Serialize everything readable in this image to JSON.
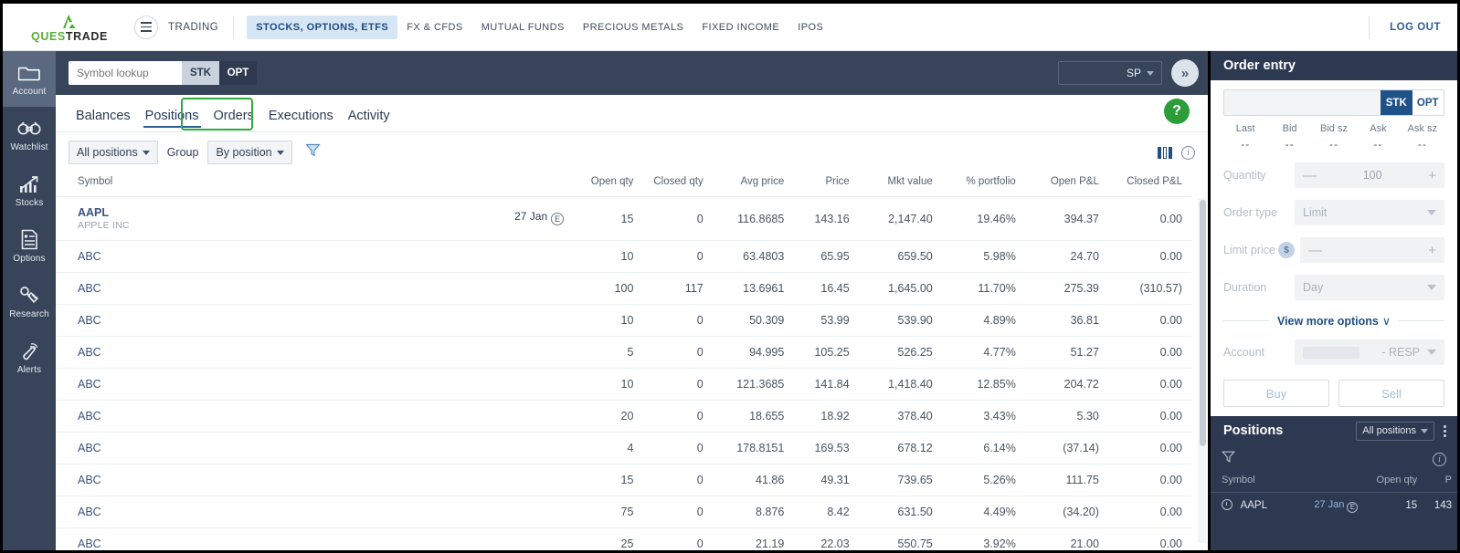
{
  "brand": {
    "name_part1": "QUES",
    "name_part2": "TRADE"
  },
  "topnav": {
    "trading_label": "TRADING",
    "items": [
      {
        "label": "STOCKS, OPTIONS, ETFS",
        "active": true
      },
      {
        "label": "FX & CFDS",
        "active": false
      },
      {
        "label": "MUTUAL FUNDS",
        "active": false
      },
      {
        "label": "PRECIOUS METALS",
        "active": false
      },
      {
        "label": "FIXED INCOME",
        "active": false
      },
      {
        "label": "IPOS",
        "active": false
      }
    ],
    "logout": "LOG OUT"
  },
  "rail": {
    "items": [
      {
        "label": "Account",
        "icon": "folder-icon",
        "active": true
      },
      {
        "label": "Watchlist",
        "icon": "binoculars-icon",
        "active": false
      },
      {
        "label": "Stocks",
        "icon": "chart-up-icon",
        "active": false
      },
      {
        "label": "Options",
        "icon": "document-person-icon",
        "active": false
      },
      {
        "label": "Research",
        "icon": "satellite-icon",
        "active": false
      },
      {
        "label": "Alerts",
        "icon": "bell-icon",
        "active": false
      }
    ]
  },
  "search": {
    "placeholder": "Symbol lookup",
    "value": "",
    "stk_label": "STK",
    "opt_label": "OPT",
    "account_selector": "SP",
    "expand_label": "»"
  },
  "tabs": [
    {
      "label": "Balances",
      "active": false
    },
    {
      "label": "Positions",
      "active": true
    },
    {
      "label": "Orders",
      "active": false
    },
    {
      "label": "Executions",
      "active": false
    },
    {
      "label": "Activity",
      "active": false
    }
  ],
  "help_label": "?",
  "toolbar": {
    "positions_filter": "All positions",
    "group_label": "Group",
    "group_value": "By position",
    "funnel_icon": "filter-funnel-icon",
    "columns_icon": "columns-icon",
    "info_icon": "info-icon"
  },
  "table": {
    "columns": [
      "Symbol",
      "Open qty",
      "Closed qty",
      "Avg price",
      "Price",
      "Mkt value",
      "% portfolio",
      "Open P&L",
      "Closed P&L"
    ],
    "rows": [
      {
        "symbol": "AAPL",
        "desc": "APPLE INC",
        "expiry": "27 Jan",
        "expiry_badge": "E",
        "open_qty": "15",
        "closed_qty": "0",
        "avg_price": "116.8685",
        "price": "143.16",
        "mkt_value": "2,147.40",
        "pct_portfolio": "19.46%",
        "open_pl": "394.37",
        "open_pl_sign": "pos",
        "closed_pl": "0.00",
        "closed_pl_sign": "neutral"
      },
      {
        "symbol": "ABC",
        "desc": "",
        "expiry": "",
        "expiry_badge": "",
        "open_qty": "10",
        "closed_qty": "0",
        "avg_price": "63.4803",
        "price": "65.95",
        "mkt_value": "659.50",
        "pct_portfolio": "5.98%",
        "open_pl": "24.70",
        "open_pl_sign": "pos",
        "closed_pl": "0.00",
        "closed_pl_sign": "neutral"
      },
      {
        "symbol": "ABC",
        "desc": "",
        "expiry": "",
        "expiry_badge": "",
        "open_qty": "100",
        "closed_qty": "117",
        "avg_price": "13.6961",
        "price": "16.45",
        "mkt_value": "1,645.00",
        "pct_portfolio": "11.70%",
        "open_pl": "275.39",
        "open_pl_sign": "pos",
        "closed_pl": "(310.57)",
        "closed_pl_sign": "neg"
      },
      {
        "symbol": "ABC",
        "desc": "",
        "expiry": "",
        "expiry_badge": "",
        "open_qty": "10",
        "closed_qty": "0",
        "avg_price": "50.309",
        "price": "53.99",
        "mkt_value": "539.90",
        "pct_portfolio": "4.89%",
        "open_pl": "36.81",
        "open_pl_sign": "pos",
        "closed_pl": "0.00",
        "closed_pl_sign": "neutral"
      },
      {
        "symbol": "ABC",
        "desc": "",
        "expiry": "",
        "expiry_badge": "",
        "open_qty": "5",
        "closed_qty": "0",
        "avg_price": "94.995",
        "price": "105.25",
        "mkt_value": "526.25",
        "pct_portfolio": "4.77%",
        "open_pl": "51.27",
        "open_pl_sign": "pos",
        "closed_pl": "0.00",
        "closed_pl_sign": "neutral"
      },
      {
        "symbol": "ABC",
        "desc": "",
        "expiry": "",
        "expiry_badge": "",
        "open_qty": "10",
        "closed_qty": "0",
        "avg_price": "121.3685",
        "price": "141.84",
        "mkt_value": "1,418.40",
        "pct_portfolio": "12.85%",
        "open_pl": "204.72",
        "open_pl_sign": "pos",
        "closed_pl": "0.00",
        "closed_pl_sign": "neutral"
      },
      {
        "symbol": "ABC",
        "desc": "",
        "expiry": "",
        "expiry_badge": "",
        "open_qty": "20",
        "closed_qty": "0",
        "avg_price": "18.655",
        "price": "18.92",
        "mkt_value": "378.40",
        "pct_portfolio": "3.43%",
        "open_pl": "5.30",
        "open_pl_sign": "pos",
        "closed_pl": "0.00",
        "closed_pl_sign": "neutral"
      },
      {
        "symbol": "ABC",
        "desc": "",
        "expiry": "",
        "expiry_badge": "",
        "open_qty": "4",
        "closed_qty": "0",
        "avg_price": "178.8151",
        "price": "169.53",
        "mkt_value": "678.12",
        "pct_portfolio": "6.14%",
        "open_pl": "(37.14)",
        "open_pl_sign": "neg",
        "closed_pl": "0.00",
        "closed_pl_sign": "neutral"
      },
      {
        "symbol": "ABC",
        "desc": "",
        "expiry": "",
        "expiry_badge": "",
        "open_qty": "15",
        "closed_qty": "0",
        "avg_price": "41.86",
        "price": "49.31",
        "mkt_value": "739.65",
        "pct_portfolio": "5.26%",
        "open_pl": "111.75",
        "open_pl_sign": "pos",
        "closed_pl": "0.00",
        "closed_pl_sign": "neutral"
      },
      {
        "symbol": "ABC",
        "desc": "",
        "expiry": "",
        "expiry_badge": "",
        "open_qty": "75",
        "closed_qty": "0",
        "avg_price": "8.876",
        "price": "8.42",
        "mkt_value": "631.50",
        "pct_portfolio": "4.49%",
        "open_pl": "(34.20)",
        "open_pl_sign": "neg",
        "closed_pl": "0.00",
        "closed_pl_sign": "neutral"
      },
      {
        "symbol": "ABC",
        "desc": "",
        "expiry": "",
        "expiry_badge": "",
        "open_qty": "25",
        "closed_qty": "0",
        "avg_price": "21.19",
        "price": "22.03",
        "mkt_value": "550.75",
        "pct_portfolio": "3.92%",
        "open_pl": "21.00",
        "open_pl_sign": "pos",
        "closed_pl": "0.00",
        "closed_pl_sign": "neutral"
      }
    ]
  },
  "order_entry": {
    "title": "Order entry",
    "symbol_value": "",
    "stk_label": "STK",
    "opt_label": "OPT",
    "quotes": [
      {
        "label": "Last",
        "value": "--"
      },
      {
        "label": "Bid",
        "value": "--"
      },
      {
        "label": "Bid sz",
        "value": "--"
      },
      {
        "label": "Ask",
        "value": "--"
      },
      {
        "label": "Ask sz",
        "value": "--"
      }
    ],
    "quantity_label": "Quantity",
    "quantity_value": "100",
    "order_type_label": "Order type",
    "order_type_value": "Limit",
    "limit_price_label": "Limit price",
    "limit_price_value": "—",
    "limit_price_badge": "$",
    "duration_label": "Duration",
    "duration_value": "Day",
    "view_more_options": "View more options",
    "view_more_chevron": "∨",
    "account_label": "Account",
    "account_value": "- RESP",
    "buy_label": "Buy",
    "sell_label": "Sell"
  },
  "positions_panel": {
    "title": "Positions",
    "filter": "All positions",
    "funnel_icon": "filter-funnel-icon",
    "info_icon": "info-icon",
    "columns": [
      "Symbol",
      "Open qty",
      "P"
    ],
    "rows": [
      {
        "symbol": "AAPL",
        "expiry": "27 Jan",
        "expiry_badge": "E",
        "open_qty": "15",
        "price": "143"
      }
    ]
  },
  "colors": {
    "brand_green": "#5ab035",
    "accent_blue": "#1f5288",
    "positive": "#2f7d52",
    "negative": "#c0392b",
    "panel_dark": "#2d3950",
    "rail_dark": "#38445a",
    "highlight_green": "#2eaa3f"
  }
}
